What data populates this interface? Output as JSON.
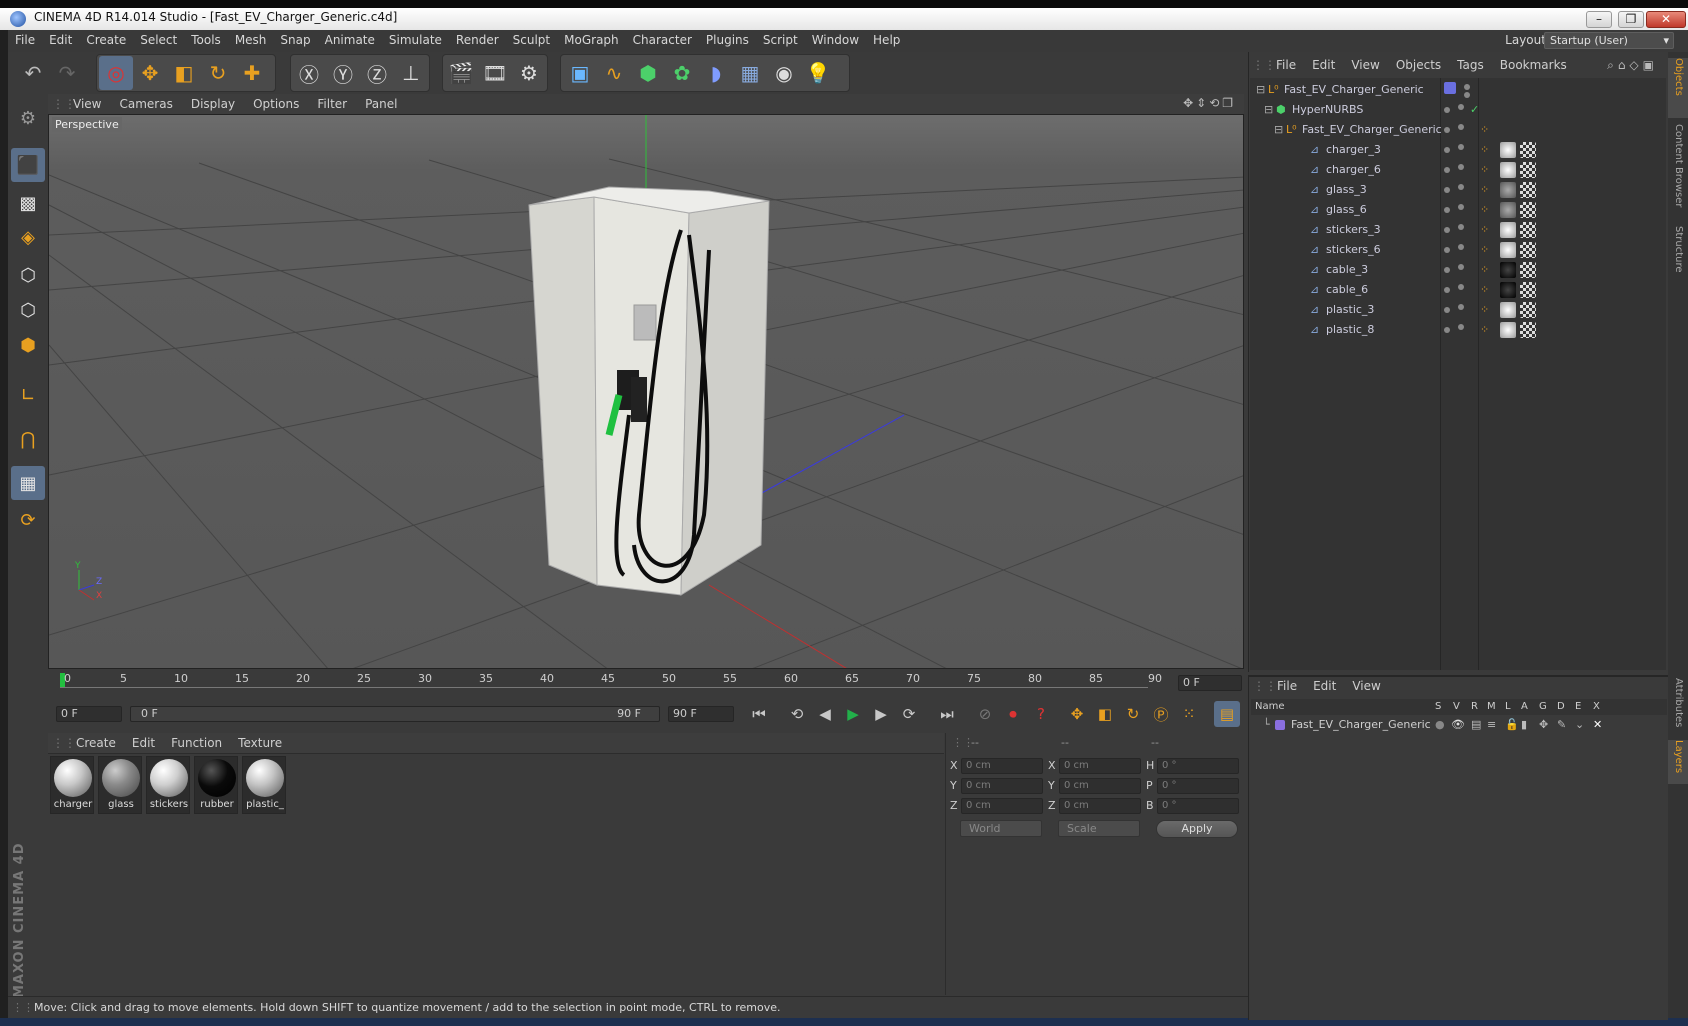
{
  "window": {
    "title": "CINEMA 4D R14.014 Studio - [Fast_EV_Charger_Generic.c4d]",
    "controls": {
      "minimize": "–",
      "maximize": "❐",
      "close": "✕"
    }
  },
  "menu": [
    "File",
    "Edit",
    "Create",
    "Select",
    "Tools",
    "Mesh",
    "Snap",
    "Animate",
    "Simulate",
    "Render",
    "Sculpt",
    "MoGraph",
    "Character",
    "Plugins",
    "Script",
    "Window",
    "Help"
  ],
  "layout": {
    "label": "Layout:",
    "value": "Startup (User)"
  },
  "viewport": {
    "menu": [
      "View",
      "Cameras",
      "Display",
      "Options",
      "Filter",
      "Panel"
    ],
    "label": "Perspective",
    "axes": {
      "y": "Y",
      "z": "Z",
      "x": "X"
    }
  },
  "timeline": {
    "ticks": [
      "0",
      "5",
      "10",
      "15",
      "20",
      "25",
      "30",
      "35",
      "40",
      "45",
      "50",
      "55",
      "60",
      "65",
      "70",
      "75",
      "80",
      "85",
      "90"
    ],
    "current_frame": "0 F",
    "start": "0 F",
    "range_start": "0 F",
    "range_end": "90 F",
    "end": "90 F"
  },
  "material_manager": {
    "menu": [
      "Create",
      "Edit",
      "Function",
      "Texture"
    ],
    "materials": [
      {
        "label": "charger",
        "color": "#c8c8c8"
      },
      {
        "label": "glass",
        "color": "#8a8a8a"
      },
      {
        "label": "stickers",
        "color": "#cfcfcf"
      },
      {
        "label": "rubber",
        "color": "#0a0a0a"
      },
      {
        "label": "plastic_",
        "color": "#c4c4c4"
      }
    ]
  },
  "coordinates": {
    "headers": [
      "--",
      "--",
      "--"
    ],
    "rows": [
      {
        "a": "X",
        "av": "0 cm",
        "b": "X",
        "bv": "0 cm",
        "c": "H",
        "cv": "0 °"
      },
      {
        "a": "Y",
        "av": "0 cm",
        "b": "Y",
        "bv": "0 cm",
        "c": "P",
        "cv": "0 °"
      },
      {
        "a": "Z",
        "av": "0 cm",
        "b": "Z",
        "bv": "0 cm",
        "c": "B",
        "cv": "0 °"
      }
    ],
    "mode": "World",
    "transform": "Scale",
    "apply": "Apply"
  },
  "object_manager": {
    "menu": [
      "File",
      "Edit",
      "View",
      "Objects",
      "Tags",
      "Bookmarks"
    ],
    "objects": [
      {
        "name": "Fast_EV_Charger_Generic",
        "depth": 0
      },
      {
        "name": "HyperNURBS",
        "depth": 1
      },
      {
        "name": "Fast_EV_Charger_Generic",
        "depth": 2
      },
      {
        "name": "charger_3",
        "depth": 3
      },
      {
        "name": "charger_6",
        "depth": 3
      },
      {
        "name": "glass_3",
        "depth": 3
      },
      {
        "name": "glass_6",
        "depth": 3
      },
      {
        "name": "stickers_3",
        "depth": 3
      },
      {
        "name": "stickers_6",
        "depth": 3
      },
      {
        "name": "cable_3",
        "depth": 3
      },
      {
        "name": "cable_6",
        "depth": 3
      },
      {
        "name": "plastic_3",
        "depth": 3
      },
      {
        "name": "plastic_8",
        "depth": 3
      }
    ]
  },
  "layer_manager": {
    "menu": [
      "File",
      "Edit",
      "View"
    ],
    "columns": [
      "Name",
      "S",
      "V",
      "R",
      "M",
      "L",
      "A",
      "G",
      "D",
      "E",
      "X"
    ],
    "layers": [
      {
        "name": "Fast_EV_Charger_Generic",
        "color": "#8a6fe0"
      }
    ]
  },
  "side_tabs": [
    "Objects",
    "Content Browser",
    "Structure",
    "Attributes",
    "Layers"
  ],
  "status": "Move: Click and drag to move elements. Hold down SHIFT to quantize movement / add to the selection in point mode, CTRL to remove.",
  "branding": "MAXON CINEMA 4D",
  "colors": {
    "accent": "#e8a020",
    "selection": "#5a6f8a",
    "play": "#22b04a"
  }
}
